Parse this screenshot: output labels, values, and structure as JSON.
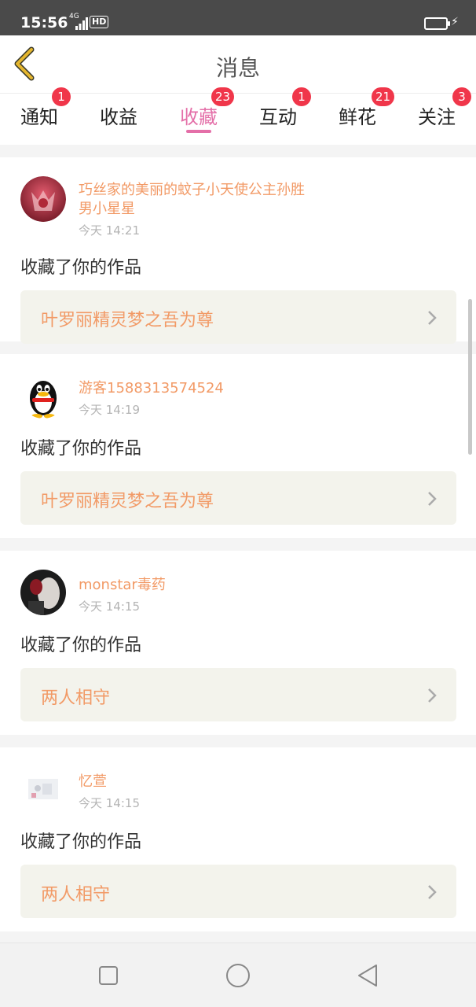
{
  "status_bar": {
    "time": "15:56",
    "network": "4G",
    "hd": "HD"
  },
  "header": {
    "title": "消息",
    "back_icon": "chevron-left-icon",
    "accent": "#e5b62e"
  },
  "tabs": [
    {
      "label": "通知",
      "badge": "1"
    },
    {
      "label": "收益",
      "badge": ""
    },
    {
      "label": "收藏",
      "badge": "23",
      "active": true
    },
    {
      "label": "互动",
      "badge": "1"
    },
    {
      "label": "鲜花",
      "badge": "21"
    },
    {
      "label": "关注",
      "badge": "3"
    }
  ],
  "colors": {
    "accent_pink": "#e46fa8",
    "badge_red": "#f0364a",
    "name_orange": "#f29a66"
  },
  "messages": [
    {
      "user": "巧丝家的美丽的蚊子小天使公主孙胜男小星星",
      "time": "今天 14:21",
      "action": "收藏了你的作品",
      "work": "叶罗丽精灵梦之吾为尊",
      "avatar": "avatar-red-fox"
    },
    {
      "user": "游客1588313574524",
      "time": "今天 14:19",
      "action": "收藏了你的作品",
      "work": "叶罗丽精灵梦之吾为尊",
      "avatar": "avatar-qq-penguin"
    },
    {
      "user": "monstar毒药",
      "time": "今天 14:15",
      "action": "收藏了你的作品",
      "work": "两人相守",
      "avatar": "avatar-photo-dark"
    },
    {
      "user": "忆萱",
      "time": "今天 14:15",
      "action": "收藏了你的作品",
      "work": "两人相守",
      "avatar": "avatar-photo-light"
    }
  ],
  "nav_bar": {
    "buttons": [
      "recents-square-icon",
      "home-circle-icon",
      "back-triangle-icon"
    ]
  }
}
